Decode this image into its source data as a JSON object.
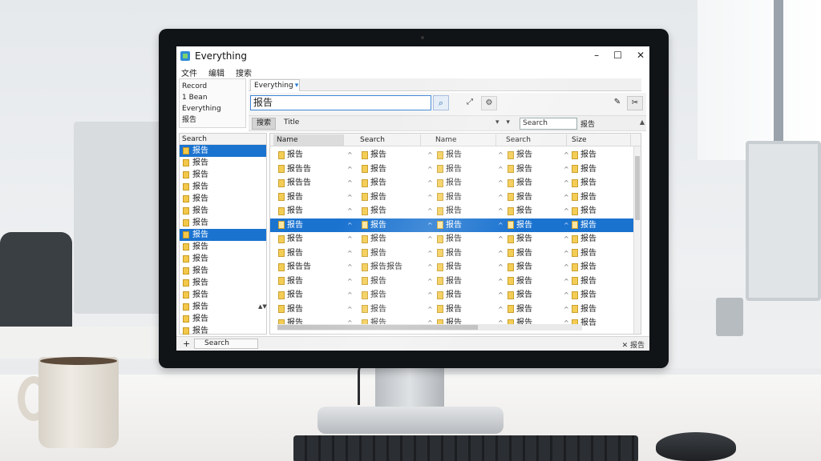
{
  "window": {
    "title": "Everything",
    "controls": [
      "–",
      "☐",
      "✕"
    ]
  },
  "menu": [
    "文件",
    "编辑",
    "搜索"
  ],
  "sidepanel": {
    "items": [
      "Record",
      "1 Bean",
      "Everything",
      "报告"
    ]
  },
  "tab": {
    "label": "Everything",
    "arrow": "▾"
  },
  "search": {
    "value": "报告",
    "button": "⌕"
  },
  "toolbar_buttons": [
    "✎",
    "⚙",
    "✂"
  ],
  "toolbar_left_button": "⤢",
  "filter": {
    "label": "搜索",
    "text": "Title",
    "arrows": "▾ ▾",
    "select": "Search",
    "extra": "报告",
    "up": "▲"
  },
  "leftlist": {
    "header": "Search",
    "rows": [
      "报告",
      "报告",
      "报告",
      "报告",
      "报告",
      "报告",
      "报告",
      "报告",
      "报告",
      "报告",
      "报告",
      "报告",
      "报告",
      "报告",
      "报告",
      "报告"
    ],
    "selected": [
      0,
      7
    ],
    "scroll": "▲▼"
  },
  "grid": {
    "headers": [
      "Name",
      "Search",
      "Name",
      "Search",
      "Size"
    ],
    "rows": [
      [
        "报告",
        "报告",
        "报告",
        "报告",
        "报告"
      ],
      [
        "报告告",
        "报告",
        "报告",
        "报告",
        "报告"
      ],
      [
        "报告告",
        "报告",
        "报告",
        "报告",
        "报告"
      ],
      [
        "报告",
        "报告",
        "报告",
        "报告",
        "报告"
      ],
      [
        "报告",
        "报告",
        "报告",
        "报告",
        "报告"
      ],
      [
        "报告",
        "报告",
        "报告",
        "报告",
        "报告"
      ],
      [
        "报告",
        "报告",
        "报告",
        "报告",
        "报告"
      ],
      [
        "报告",
        "报告",
        "报告",
        "报告",
        "报告"
      ],
      [
        "报告告",
        "报告报告",
        "报告",
        "报告",
        "报告"
      ],
      [
        "报告",
        "报告",
        "报告",
        "报告",
        "报告"
      ],
      [
        "报告",
        "报告",
        "报告",
        "报告",
        "报告"
      ],
      [
        "报告",
        "报告",
        "报告",
        "报告",
        "报告"
      ],
      [
        "报告",
        "报告",
        "报告",
        "报告",
        "报告"
      ]
    ],
    "selected_row": 5,
    "marker": "^"
  },
  "status": {
    "plus": "+",
    "text": "Search",
    "right": "✕ 报告"
  }
}
